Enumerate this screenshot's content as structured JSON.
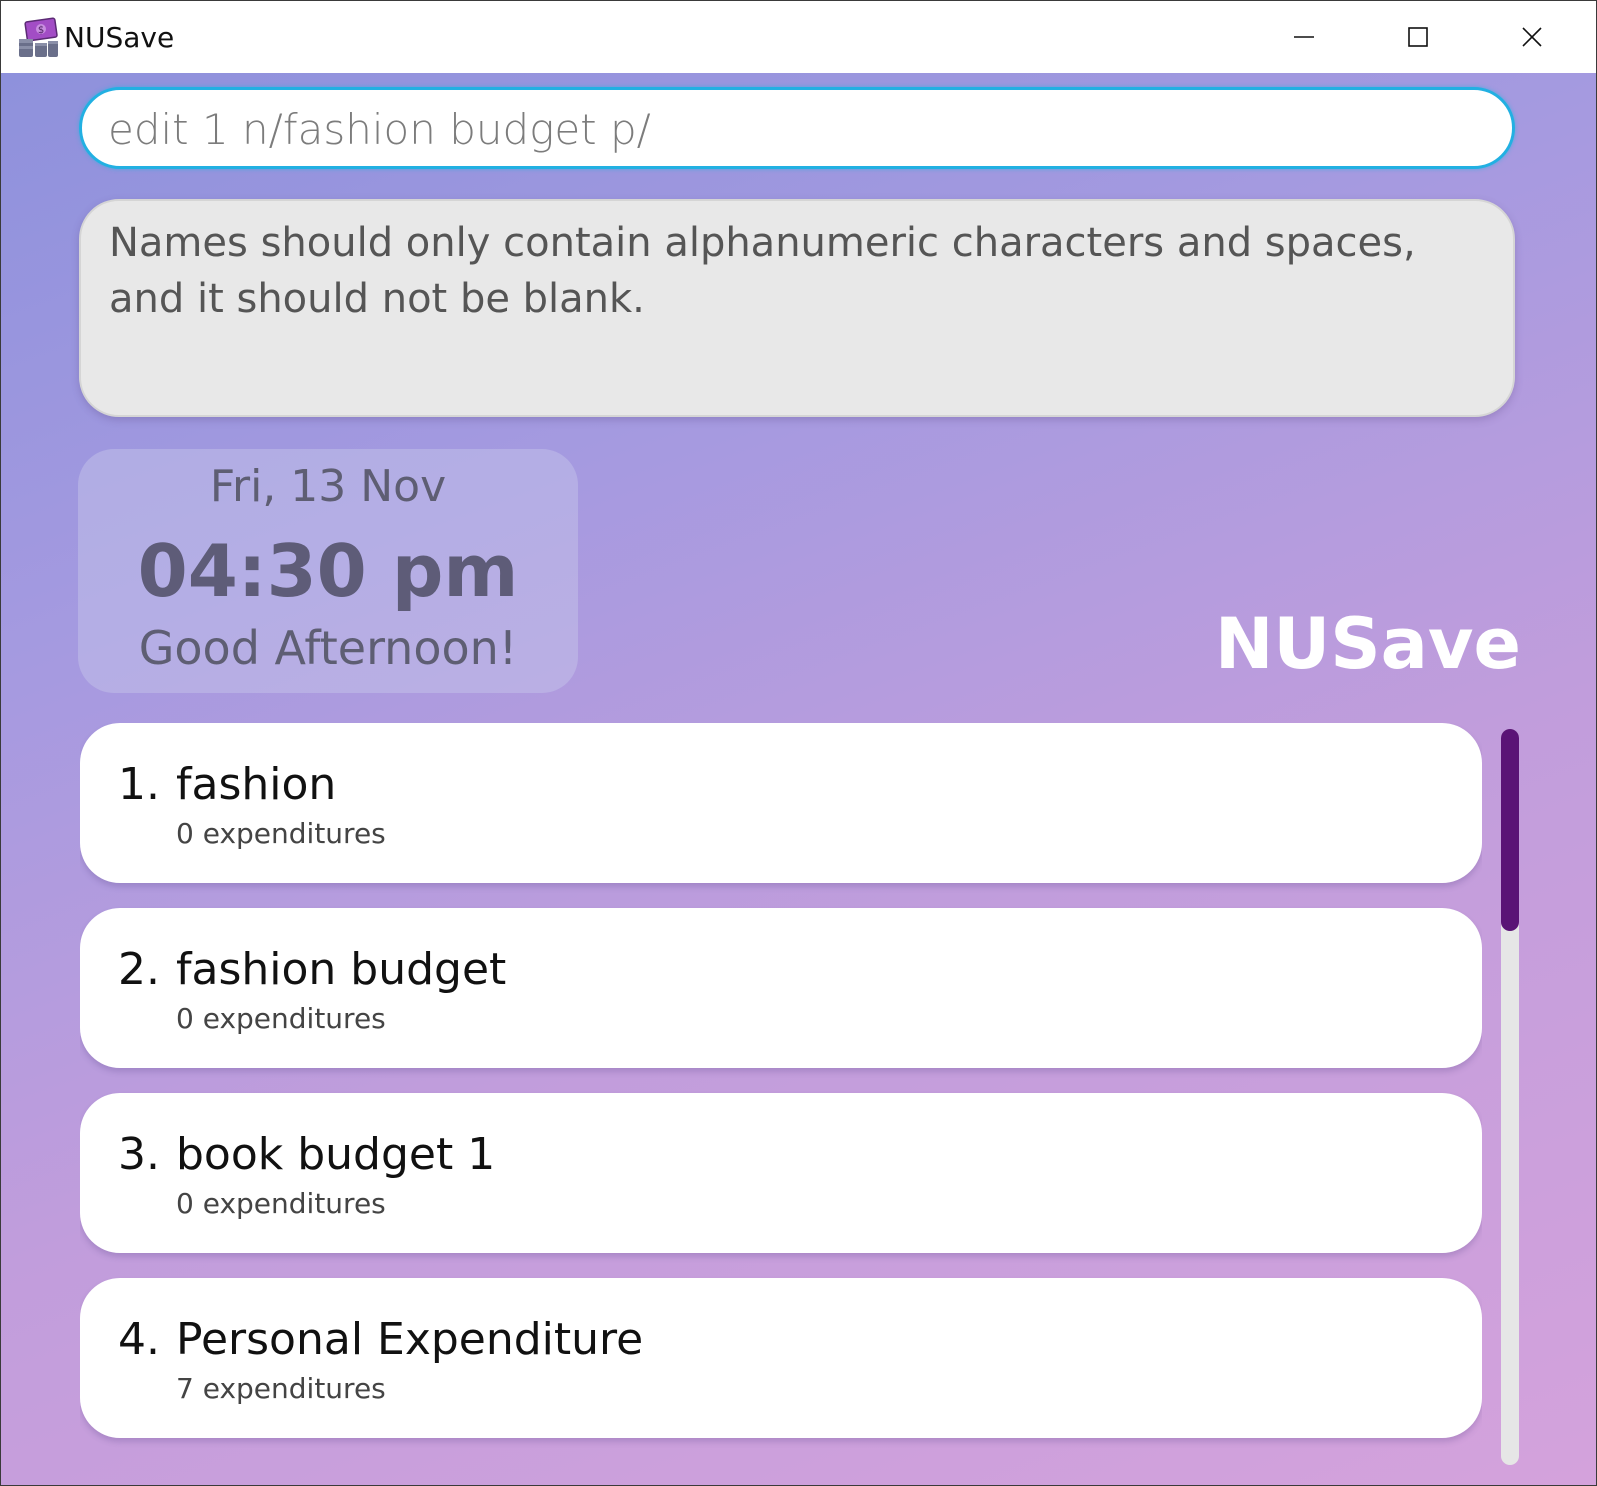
{
  "window": {
    "title": "NUSave",
    "app_icon": "money-stack-icon",
    "controls": [
      "minimize-icon",
      "maximize-icon",
      "close-icon"
    ]
  },
  "command": {
    "value": "edit 1 n/fashion budget p/"
  },
  "result": {
    "message": "Names should only contain alphanumeric characters and spaces, and it should not be blank."
  },
  "clock": {
    "date": "Fri, 13 Nov",
    "time": "04:30 pm",
    "greeting": "Good Afternoon!"
  },
  "brand": {
    "label": "NUSave"
  },
  "budgets": [
    {
      "index": "1.",
      "name": "fashion",
      "count": "0 expenditures"
    },
    {
      "index": "2.",
      "name": "fashion budget",
      "count": "0 expenditures"
    },
    {
      "index": "3.",
      "name": "book budget 1",
      "count": "0 expenditures"
    },
    {
      "index": "4.",
      "name": "Personal Expenditure",
      "count": "7 expenditures"
    }
  ],
  "colors": {
    "accent": "#22b0e2",
    "scrollbar_thumb": "#5a1476",
    "gradient_start": "#8e91dc",
    "gradient_end": "#d4a2dc"
  }
}
